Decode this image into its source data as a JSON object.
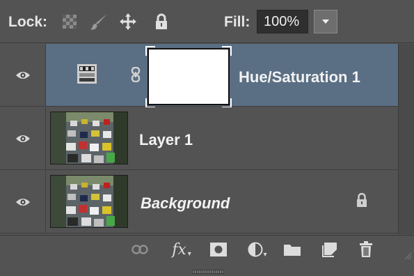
{
  "lock_bar": {
    "lock_label": "Lock:",
    "fill_label": "Fill:",
    "fill_value": "100%"
  },
  "layers": [
    {
      "name": "Hue/Saturation 1",
      "type": "adjustment",
      "selected": true,
      "visible": true
    },
    {
      "name": "Layer 1",
      "type": "pixel",
      "selected": false,
      "visible": true
    },
    {
      "name": "Background",
      "type": "background",
      "selected": false,
      "visible": true,
      "locked": true,
      "italic": true
    }
  ],
  "toolbar": {
    "icons": [
      "link-layers-icon",
      "fx-icon",
      "layer-mask-icon",
      "adjustment-layer-icon",
      "group-folder-icon",
      "new-layer-icon",
      "trash-icon"
    ],
    "fx_label": "fx"
  },
  "colors": {
    "panel_bg": "#535353",
    "selected_row": "#5a6e84",
    "text": "#e6e6e6"
  }
}
